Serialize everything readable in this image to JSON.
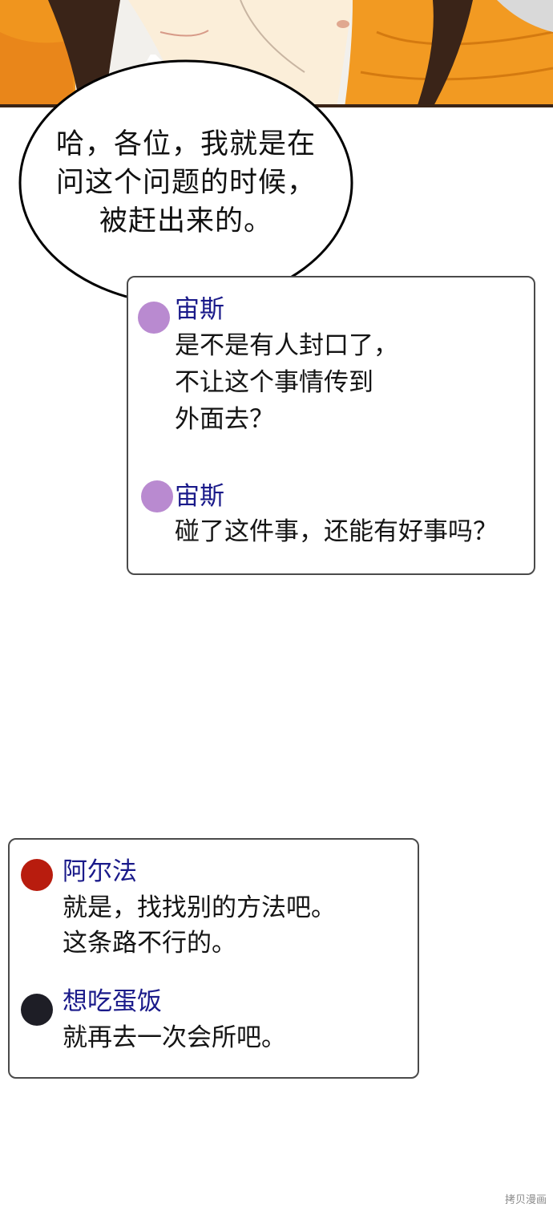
{
  "speech_bubble": {
    "lines": [
      "哈，各位，我就是在",
      "问这个问题的时候，",
      "被赶出来的。"
    ]
  },
  "chat1": {
    "messages": [
      {
        "name": "宙斯",
        "avatar_color": "#b98ad0",
        "lines": [
          "是不是有人封口了，",
          "不让这个事情传到",
          "外面去？"
        ]
      },
      {
        "name": "宙斯",
        "avatar_color": "#b98ad0",
        "lines": [
          "碰了这件事，还能有好事吗？"
        ]
      }
    ]
  },
  "chat2": {
    "messages": [
      {
        "name": "阿尔法",
        "avatar_color": "#b81c0e",
        "lines": [
          "就是，找找别的方法吧。",
          "这条路不行的。"
        ]
      },
      {
        "name": "想吃蛋饭",
        "avatar_color": "#1e1e26",
        "lines": [
          "就再去一次会所吧。"
        ]
      }
    ]
  },
  "watermark": "拷贝漫画"
}
